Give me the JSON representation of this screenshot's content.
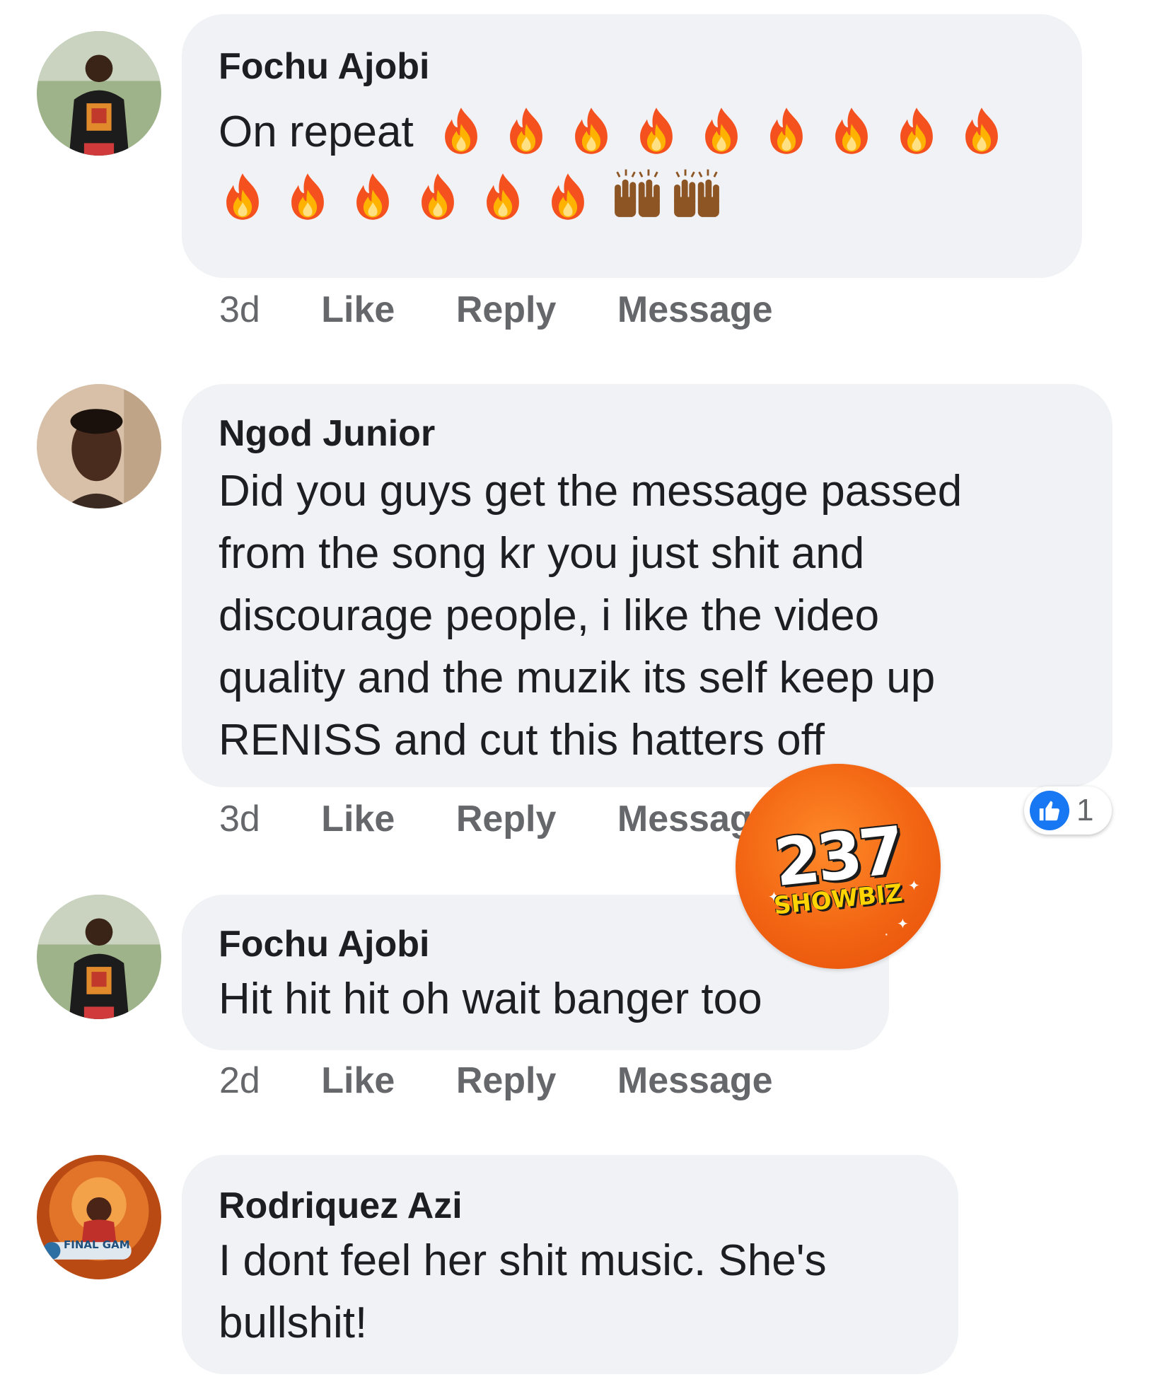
{
  "comments": [
    {
      "author": "Fochu Ajobi",
      "text": "On repeat",
      "emoji_line1": {
        "fire": 9
      },
      "emoji_line2": {
        "fire": 6,
        "raised_hands": 2
      },
      "time": "3d",
      "like_label": "Like",
      "reply_label": "Reply",
      "message_label": "Message",
      "avatar_icon": "profile-photo"
    },
    {
      "author": "Ngod Junior",
      "text": "Did you guys get the message passed\nfrom the song kr you just shit and\ndiscourage people, i like the video\nquality and the muzik its self keep up\nRENISS and cut this hatters off",
      "time": "3d",
      "like_label": "Like",
      "reply_label": "Reply",
      "message_label": "Message",
      "reaction_count": "1",
      "reaction_icon": "thumbs-up-icon",
      "avatar_icon": "profile-photo"
    },
    {
      "author": "Fochu Ajobi",
      "text": "Hit hit hit oh wait banger too",
      "time": "2d",
      "like_label": "Like",
      "reply_label": "Reply",
      "message_label": "Message",
      "avatar_icon": "profile-photo"
    },
    {
      "author": "Rodriquez Azi",
      "text": "I dont feel her shit music. She's\nbullshit!",
      "avatar_badge": "FINAL GAM",
      "avatar_icon": "profile-photo"
    }
  ],
  "watermark": {
    "number": "237",
    "brand": "SHOWBIZ"
  },
  "colors": {
    "bubble": "#f0f2f5",
    "text": "#1c1e21",
    "meta": "#65676b",
    "like_blue": "#1877f2",
    "watermark_orange": "#f26412"
  }
}
